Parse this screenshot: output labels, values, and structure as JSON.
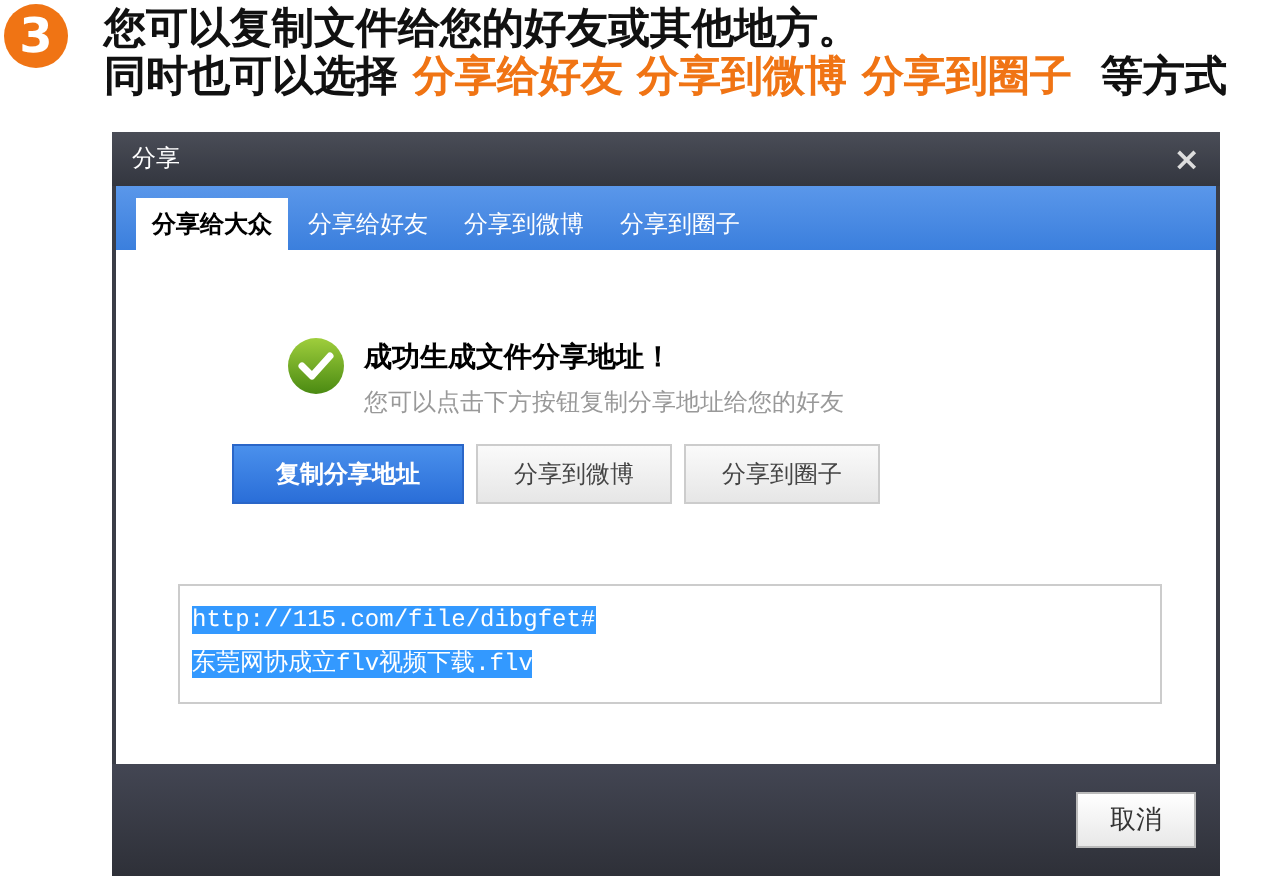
{
  "step": {
    "number": "3",
    "line_1": "您可以复制文件给您的好友或其他地方。",
    "line_2": [
      {
        "text": "同时也可以选择 ",
        "highlight": false
      },
      {
        "text": "分享给好友 分享到微博 分享到圈子",
        "highlight": true
      },
      {
        "text": "  等方式",
        "highlight": false
      }
    ]
  },
  "dialog": {
    "title": "分享",
    "close": "×",
    "tabs": [
      {
        "label": "分享给大众",
        "selected": true
      },
      {
        "label": "分享给好友",
        "selected": false
      },
      {
        "label": "分享到微博",
        "selected": false
      },
      {
        "label": "分享到圈子",
        "selected": false
      }
    ],
    "message": {
      "title": "成功生成文件分享地址！",
      "hint": "您可以点击下方按钮复制分享地址给您的好友"
    },
    "buttons": [
      {
        "label": "复制分享地址",
        "kind": "primary"
      },
      {
        "label": "分享到微博",
        "kind": "secondary"
      },
      {
        "label": "分享到圈子",
        "kind": "secondary"
      }
    ],
    "link_field": {
      "lines": [
        "http://115.com/file/dibgfet# ",
        "东莞网协成立flv视频下载.flv"
      ],
      "selected": true
    },
    "footer_buttons": [
      "取消"
    ]
  }
}
